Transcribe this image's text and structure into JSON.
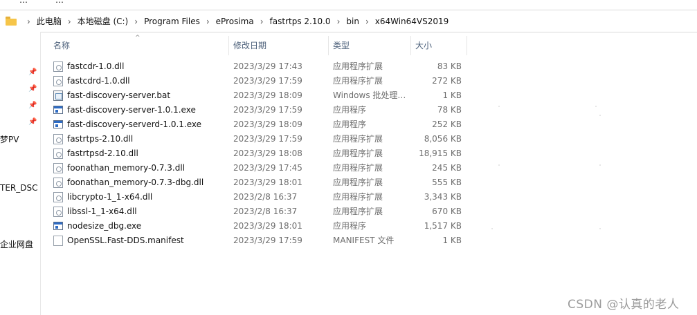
{
  "top_fragments": [
    "…",
    "…"
  ],
  "address_bar": {
    "icon": "folder-icon",
    "crumbs": [
      "此电脑",
      "本地磁盘 (C:)",
      "Program Files",
      "eProsima",
      "fastrtps 2.10.0",
      "bin",
      "x64Win64VS2019"
    ]
  },
  "nav": {
    "pins": [
      "pin-icon",
      "pin-icon",
      "pin-icon",
      "pin-icon"
    ],
    "labels": [
      "梦PV",
      "TER_DSC",
      "企业网盘"
    ]
  },
  "columns": {
    "name": "名称",
    "date": "修改日期",
    "type": "类型",
    "size": "大小"
  },
  "files": [
    {
      "name": "fastcdr-1.0.dll",
      "date": "2023/3/29 17:43",
      "type": "应用程序扩展",
      "size": "83 KB",
      "icon": "dll-icon"
    },
    {
      "name": "fastcdrd-1.0.dll",
      "date": "2023/3/29 17:59",
      "type": "应用程序扩展",
      "size": "272 KB",
      "icon": "dll-icon"
    },
    {
      "name": "fast-discovery-server.bat",
      "date": "2023/3/29 18:09",
      "type": "Windows 批处理…",
      "size": "1 KB",
      "icon": "bat-icon"
    },
    {
      "name": "fast-discovery-server-1.0.1.exe",
      "date": "2023/3/29 17:59",
      "type": "应用程序",
      "size": "78 KB",
      "icon": "exe-icon"
    },
    {
      "name": "fast-discovery-serverd-1.0.1.exe",
      "date": "2023/3/29 18:09",
      "type": "应用程序",
      "size": "252 KB",
      "icon": "exe-icon"
    },
    {
      "name": "fastrtps-2.10.dll",
      "date": "2023/3/29 17:59",
      "type": "应用程序扩展",
      "size": "8,056 KB",
      "icon": "dll-icon"
    },
    {
      "name": "fastrtpsd-2.10.dll",
      "date": "2023/3/29 18:08",
      "type": "应用程序扩展",
      "size": "18,915 KB",
      "icon": "dll-icon"
    },
    {
      "name": "foonathan_memory-0.7.3.dll",
      "date": "2023/3/29 17:45",
      "type": "应用程序扩展",
      "size": "245 KB",
      "icon": "dll-icon"
    },
    {
      "name": "foonathan_memory-0.7.3-dbg.dll",
      "date": "2023/3/29 18:01",
      "type": "应用程序扩展",
      "size": "555 KB",
      "icon": "dll-icon"
    },
    {
      "name": "libcrypto-1_1-x64.dll",
      "date": "2023/2/8 16:37",
      "type": "应用程序扩展",
      "size": "3,343 KB",
      "icon": "dll-icon"
    },
    {
      "name": "libssl-1_1-x64.dll",
      "date": "2023/2/8 16:37",
      "type": "应用程序扩展",
      "size": "670 KB",
      "icon": "dll-icon"
    },
    {
      "name": "nodesize_dbg.exe",
      "date": "2023/3/29 18:01",
      "type": "应用程序",
      "size": "1,517 KB",
      "icon": "exe-icon"
    },
    {
      "name": "OpenSSL.Fast-DDS.manifest",
      "date": "2023/3/29 17:59",
      "type": "MANIFEST 文件",
      "size": "1 KB",
      "icon": "manifest-icon"
    }
  ],
  "watermark": "CSDN @认真的老人"
}
